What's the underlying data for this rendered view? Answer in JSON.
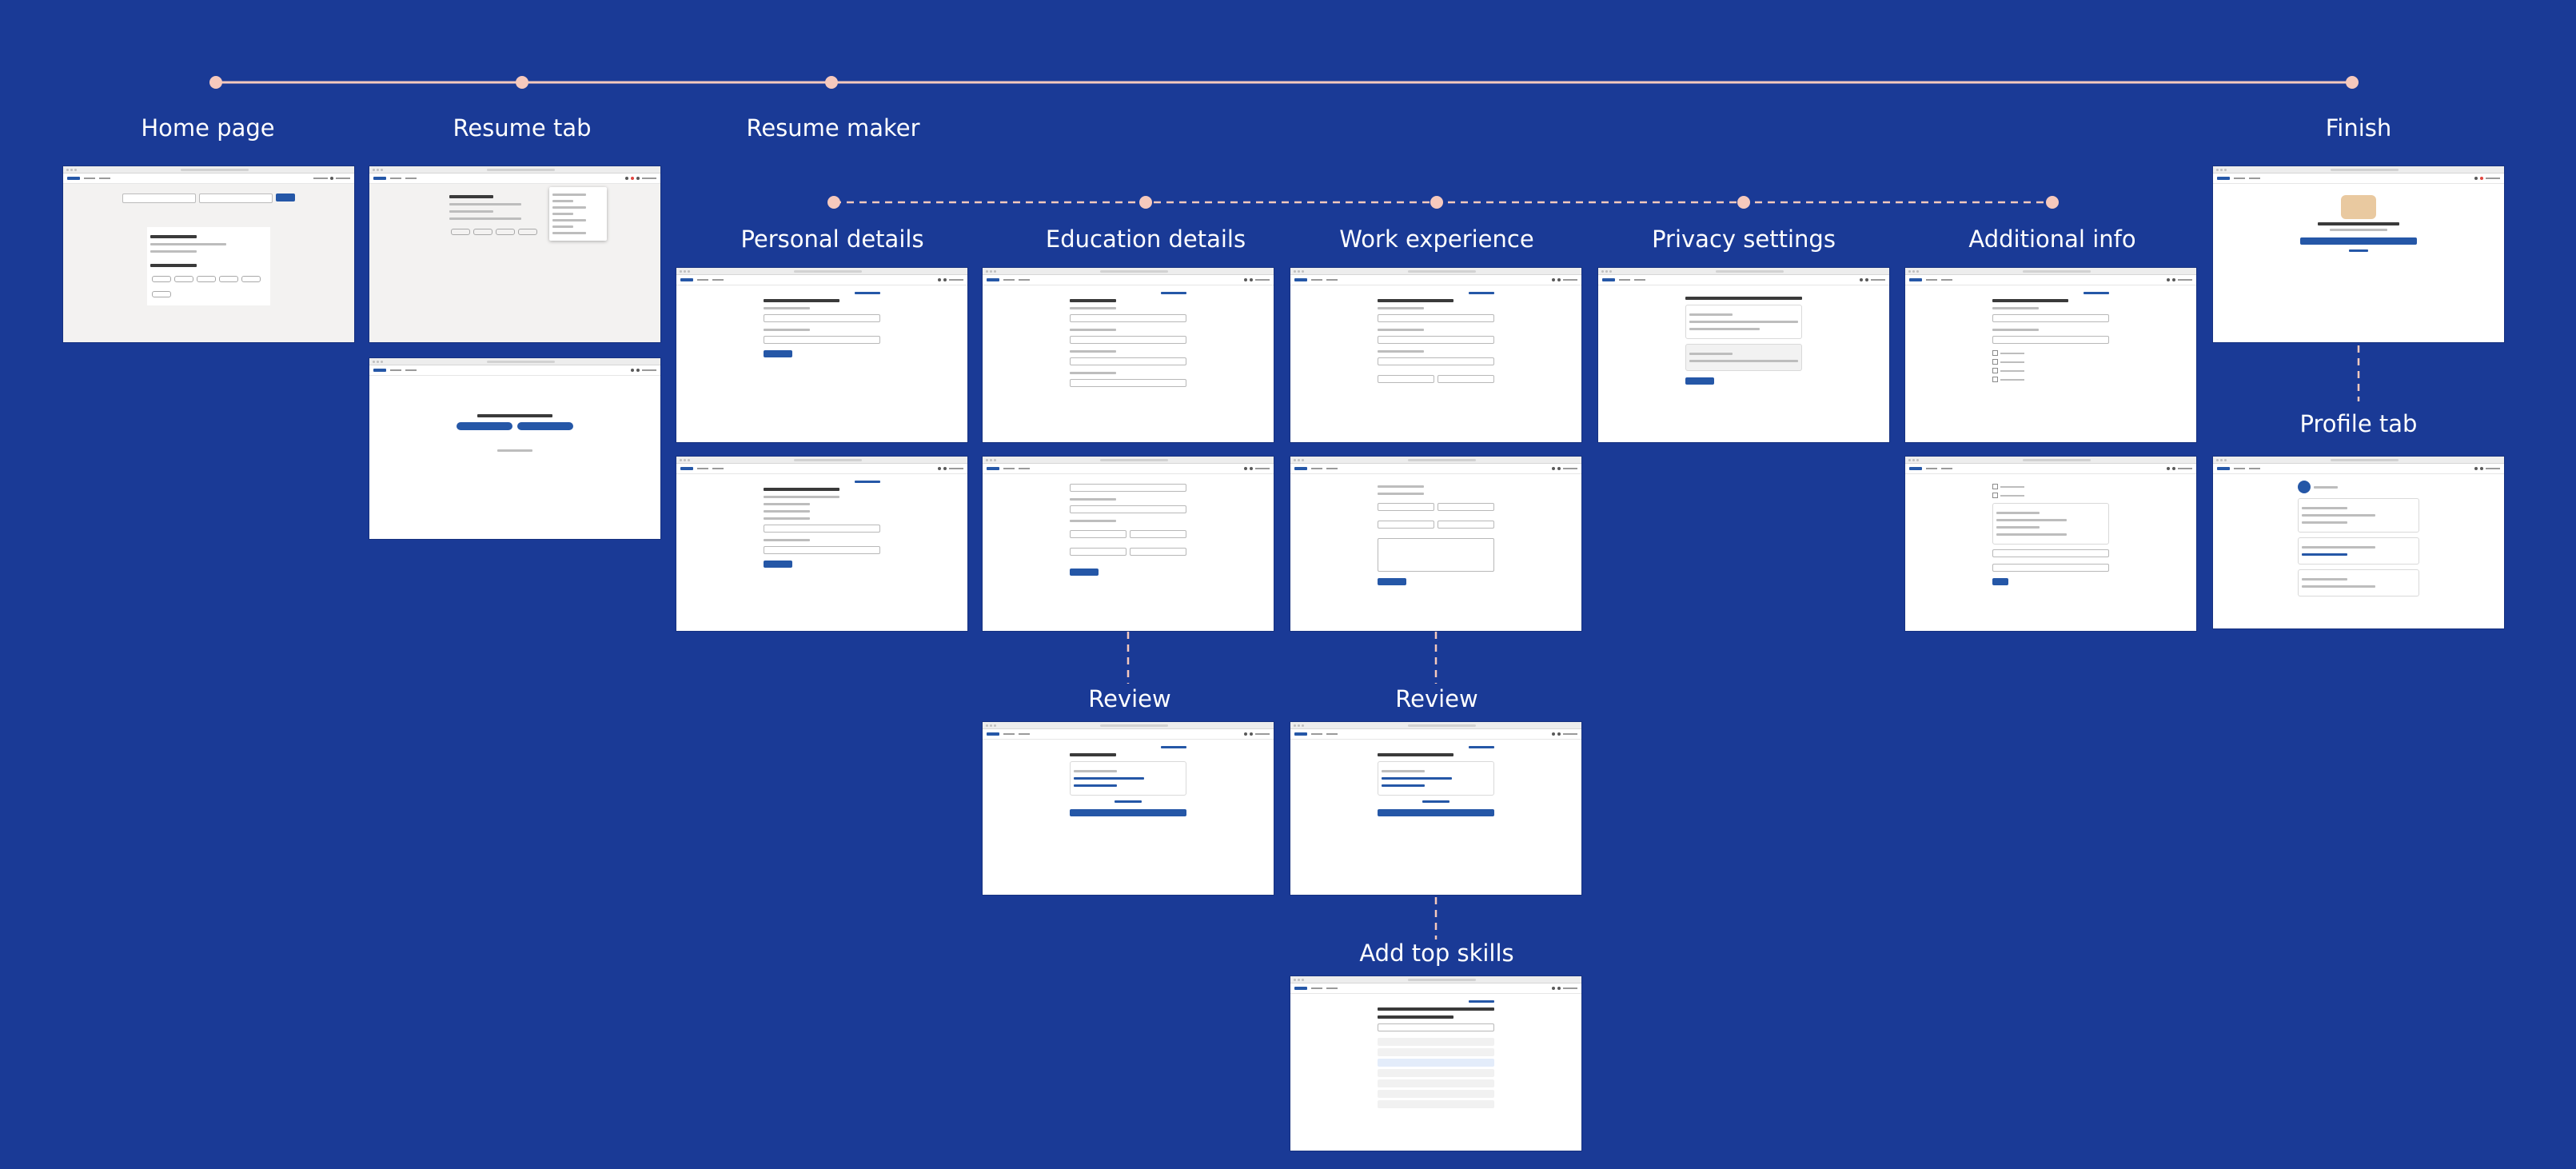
{
  "flow": {
    "main_steps": {
      "home_page": "Home page",
      "resume_tab": "Resume tab",
      "resume_maker": "Resume maker",
      "finish": "Finish",
      "profile_tab": "Profile tab"
    },
    "sub_steps": {
      "personal_details": "Personal details",
      "education_details": "Education details",
      "work_experience": "Work experience",
      "privacy_settings": "Privacy settings",
      "additional_info": "Additional info"
    },
    "branches": {
      "education_review": "Review",
      "work_review": "Review",
      "add_top_skills": "Add top skills"
    }
  },
  "colors": {
    "background": "#1a3a96",
    "connector_dot": "#f6c9bd",
    "connector_line": "#f6c9bd",
    "label_text": "#ffffff",
    "screenshot_accent": "#2557a7"
  }
}
